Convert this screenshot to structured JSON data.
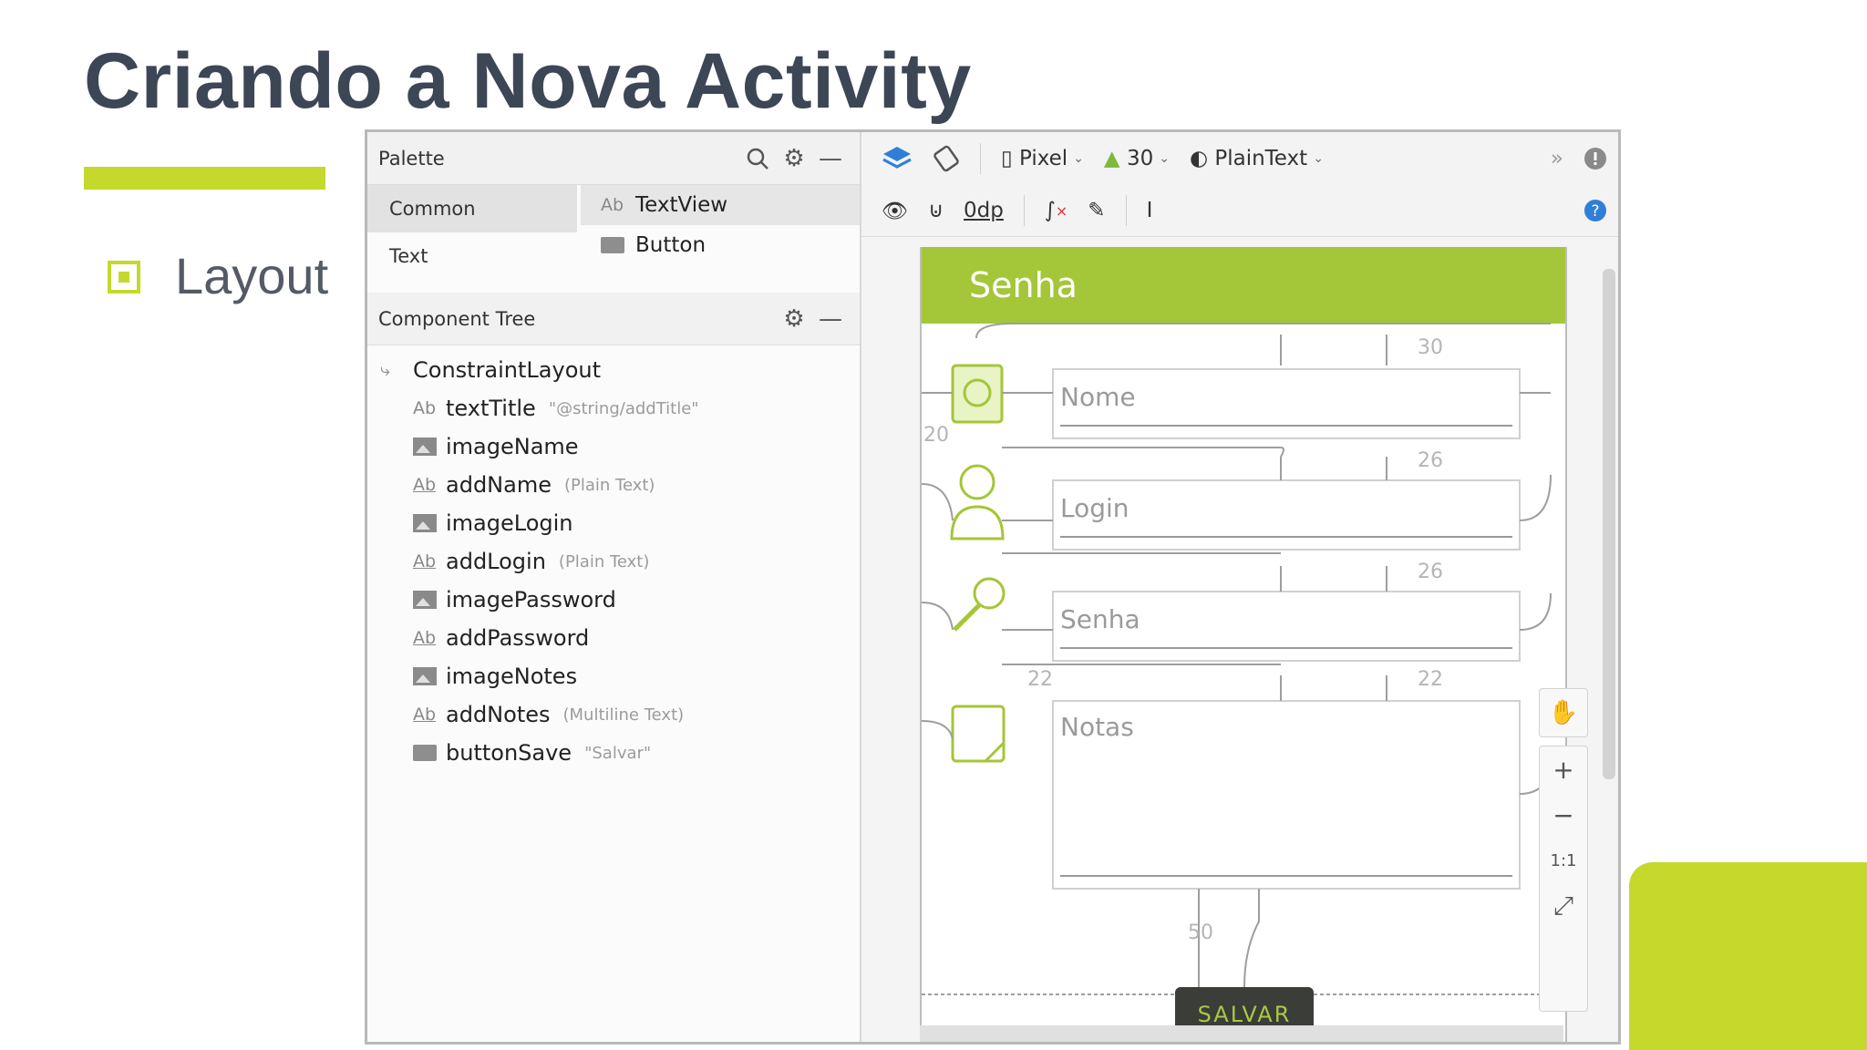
{
  "slide": {
    "title": "Criando a Nova Activity",
    "bullet": "Layout"
  },
  "palette": {
    "header": "Palette",
    "categories": [
      "Common",
      "Text"
    ],
    "items": [
      "TextView",
      "Button"
    ]
  },
  "component_tree": {
    "header": "Component Tree",
    "root": "ConstraintLayout",
    "nodes": [
      {
        "icon": "text-icon",
        "name": "textTitle",
        "attr": "\"@string/addTitle\""
      },
      {
        "icon": "image-icon",
        "name": "imageName",
        "attr": ""
      },
      {
        "icon": "edittext-icon",
        "name": "addName",
        "attr": "(Plain Text)"
      },
      {
        "icon": "image-icon",
        "name": "imageLogin",
        "attr": ""
      },
      {
        "icon": "edittext-icon",
        "name": "addLogin",
        "attr": "(Plain Text)"
      },
      {
        "icon": "image-icon",
        "name": "imagePassword",
        "attr": ""
      },
      {
        "icon": "edittext-icon",
        "name": "addPassword",
        "attr": ""
      },
      {
        "icon": "image-icon",
        "name": "imageNotes",
        "attr": ""
      },
      {
        "icon": "edittext-icon",
        "name": "addNotes",
        "attr": "(Multiline Text)"
      },
      {
        "icon": "button-icon",
        "name": "buttonSave",
        "attr": "\"Salvar\""
      }
    ]
  },
  "toolbar": {
    "device": "Pixel",
    "api": "30",
    "theme": "PlainText",
    "margin": "0dp"
  },
  "preview": {
    "appbar_title": "Senha",
    "fields": [
      "Nome",
      "Login",
      "Senha",
      "Notas"
    ],
    "margins": [
      "30",
      "20",
      "26",
      "26",
      "22",
      "22",
      "50"
    ],
    "save_button": "SALVAR",
    "zoom_ratio": "1:1"
  },
  "colors": {
    "accent": "#c5d92d",
    "appbar": "#a4c639",
    "title": "#3d4655"
  }
}
